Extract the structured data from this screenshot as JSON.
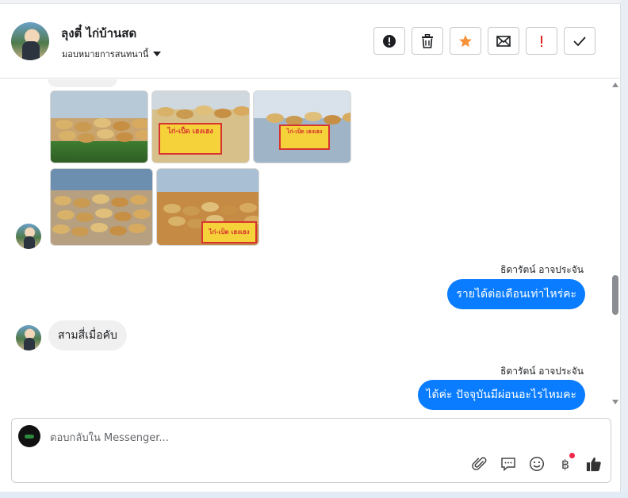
{
  "header": {
    "contact_name": "ลุงตี๋ ไก่บ้านสด",
    "assign_label": "มอบหมายการสนทนานี้",
    "actions": [
      {
        "name": "report-spam-button",
        "icon": "alert-circle-icon"
      },
      {
        "name": "delete-button",
        "icon": "trash-icon"
      },
      {
        "name": "star-button",
        "icon": "star-icon"
      },
      {
        "name": "mark-unread-button",
        "icon": "envelope-icon"
      },
      {
        "name": "follow-up-button",
        "icon": "exclamation-icon"
      },
      {
        "name": "mark-done-button",
        "icon": "check-icon"
      }
    ]
  },
  "colors": {
    "accent": "#0a7cff",
    "star": "#f7923a",
    "follow_up": "#e02020",
    "incoming_bubble": "#f0f0f0",
    "notification_dot": "#f02849"
  },
  "messages": [
    {
      "type": "images",
      "from": "contact",
      "count": 5,
      "sign_text": "ไก่-เป็ด เฮงเฮง"
    },
    {
      "type": "text",
      "from": "page",
      "sender": "ธิดารัตน์ อาจประจัน",
      "text": "รายได้ต่อเดือนเท่าไหร่คะ"
    },
    {
      "type": "text",
      "from": "contact",
      "text": "สามสี่เมื่อคับ"
    },
    {
      "type": "text",
      "from": "page",
      "sender": "ธิดารัตน์ อาจประจัน",
      "text": "ได้ค่ะ ปัจจุบันมีผ่อนอะไรไหมคะ"
    }
  ],
  "composer": {
    "placeholder": "ตอบกลับใน Messenger...",
    "tools": [
      "paperclip-icon",
      "saved-reply-icon",
      "emoji-icon",
      "baht-payment-icon",
      "thumbs-up-icon"
    ],
    "baht_symbol": "฿"
  }
}
